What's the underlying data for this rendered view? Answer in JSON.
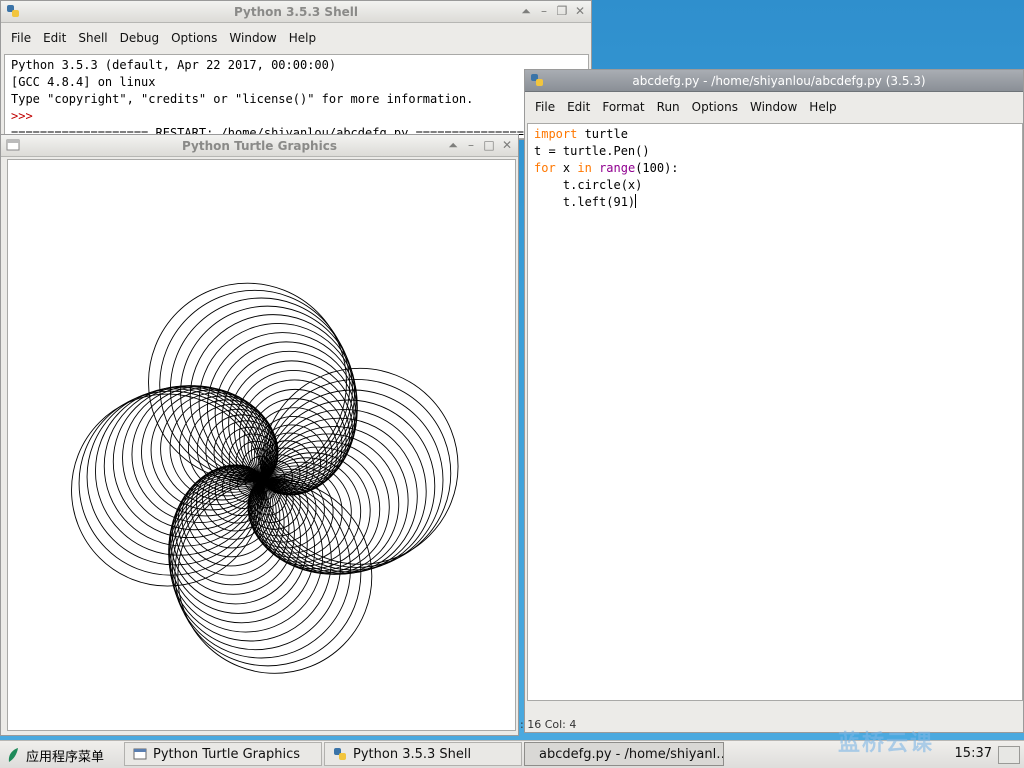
{
  "shell": {
    "title": "Python 3.5.3 Shell",
    "menu": [
      "File",
      "Edit",
      "Shell",
      "Debug",
      "Options",
      "Window",
      "Help"
    ],
    "lines": [
      "Python 3.5.3 (default, Apr 22 2017, 00:00:00)",
      "[GCC 4.8.4] on linux",
      "Type \"copyright\", \"credits\" or \"license()\" for more information."
    ],
    "prompt": ">>>",
    "restart_line": "=================== RESTART: /home/shiyanlou/abcdefg.py =================="
  },
  "turtle": {
    "title": "Python Turtle Graphics",
    "circles": 100,
    "turn_angle": 91
  },
  "editor": {
    "title": "abcdefg.py - /home/shiyanlou/abcdefg.py (3.5.3)",
    "menu": [
      "File",
      "Edit",
      "Format",
      "Run",
      "Options",
      "Window",
      "Help"
    ],
    "code": {
      "l1_kw": "import",
      "l1_rest": " turtle",
      "l2": "t = turtle.Pen()",
      "l3_kw1": "for",
      "l3_a": " x ",
      "l3_kw2": "in",
      "l3_sp": " ",
      "l3_bi": "range",
      "l3_b": "(100):",
      "l4": "    t.circle(x)",
      "l5": "    t.left(91)"
    },
    "status": ": 16   Col: 4"
  },
  "taskbar": {
    "start_label": "应用程序菜单",
    "tasks": [
      "Python Turtle Graphics",
      "Python 3.5.3 Shell",
      "abcdefg.py - /home/shiyanl…"
    ],
    "clock": "15:37"
  },
  "watermark": "蓝桥云课",
  "colors": {
    "keyword": "#ff7700",
    "builtin": "#900090",
    "prompt": "#c00000"
  }
}
